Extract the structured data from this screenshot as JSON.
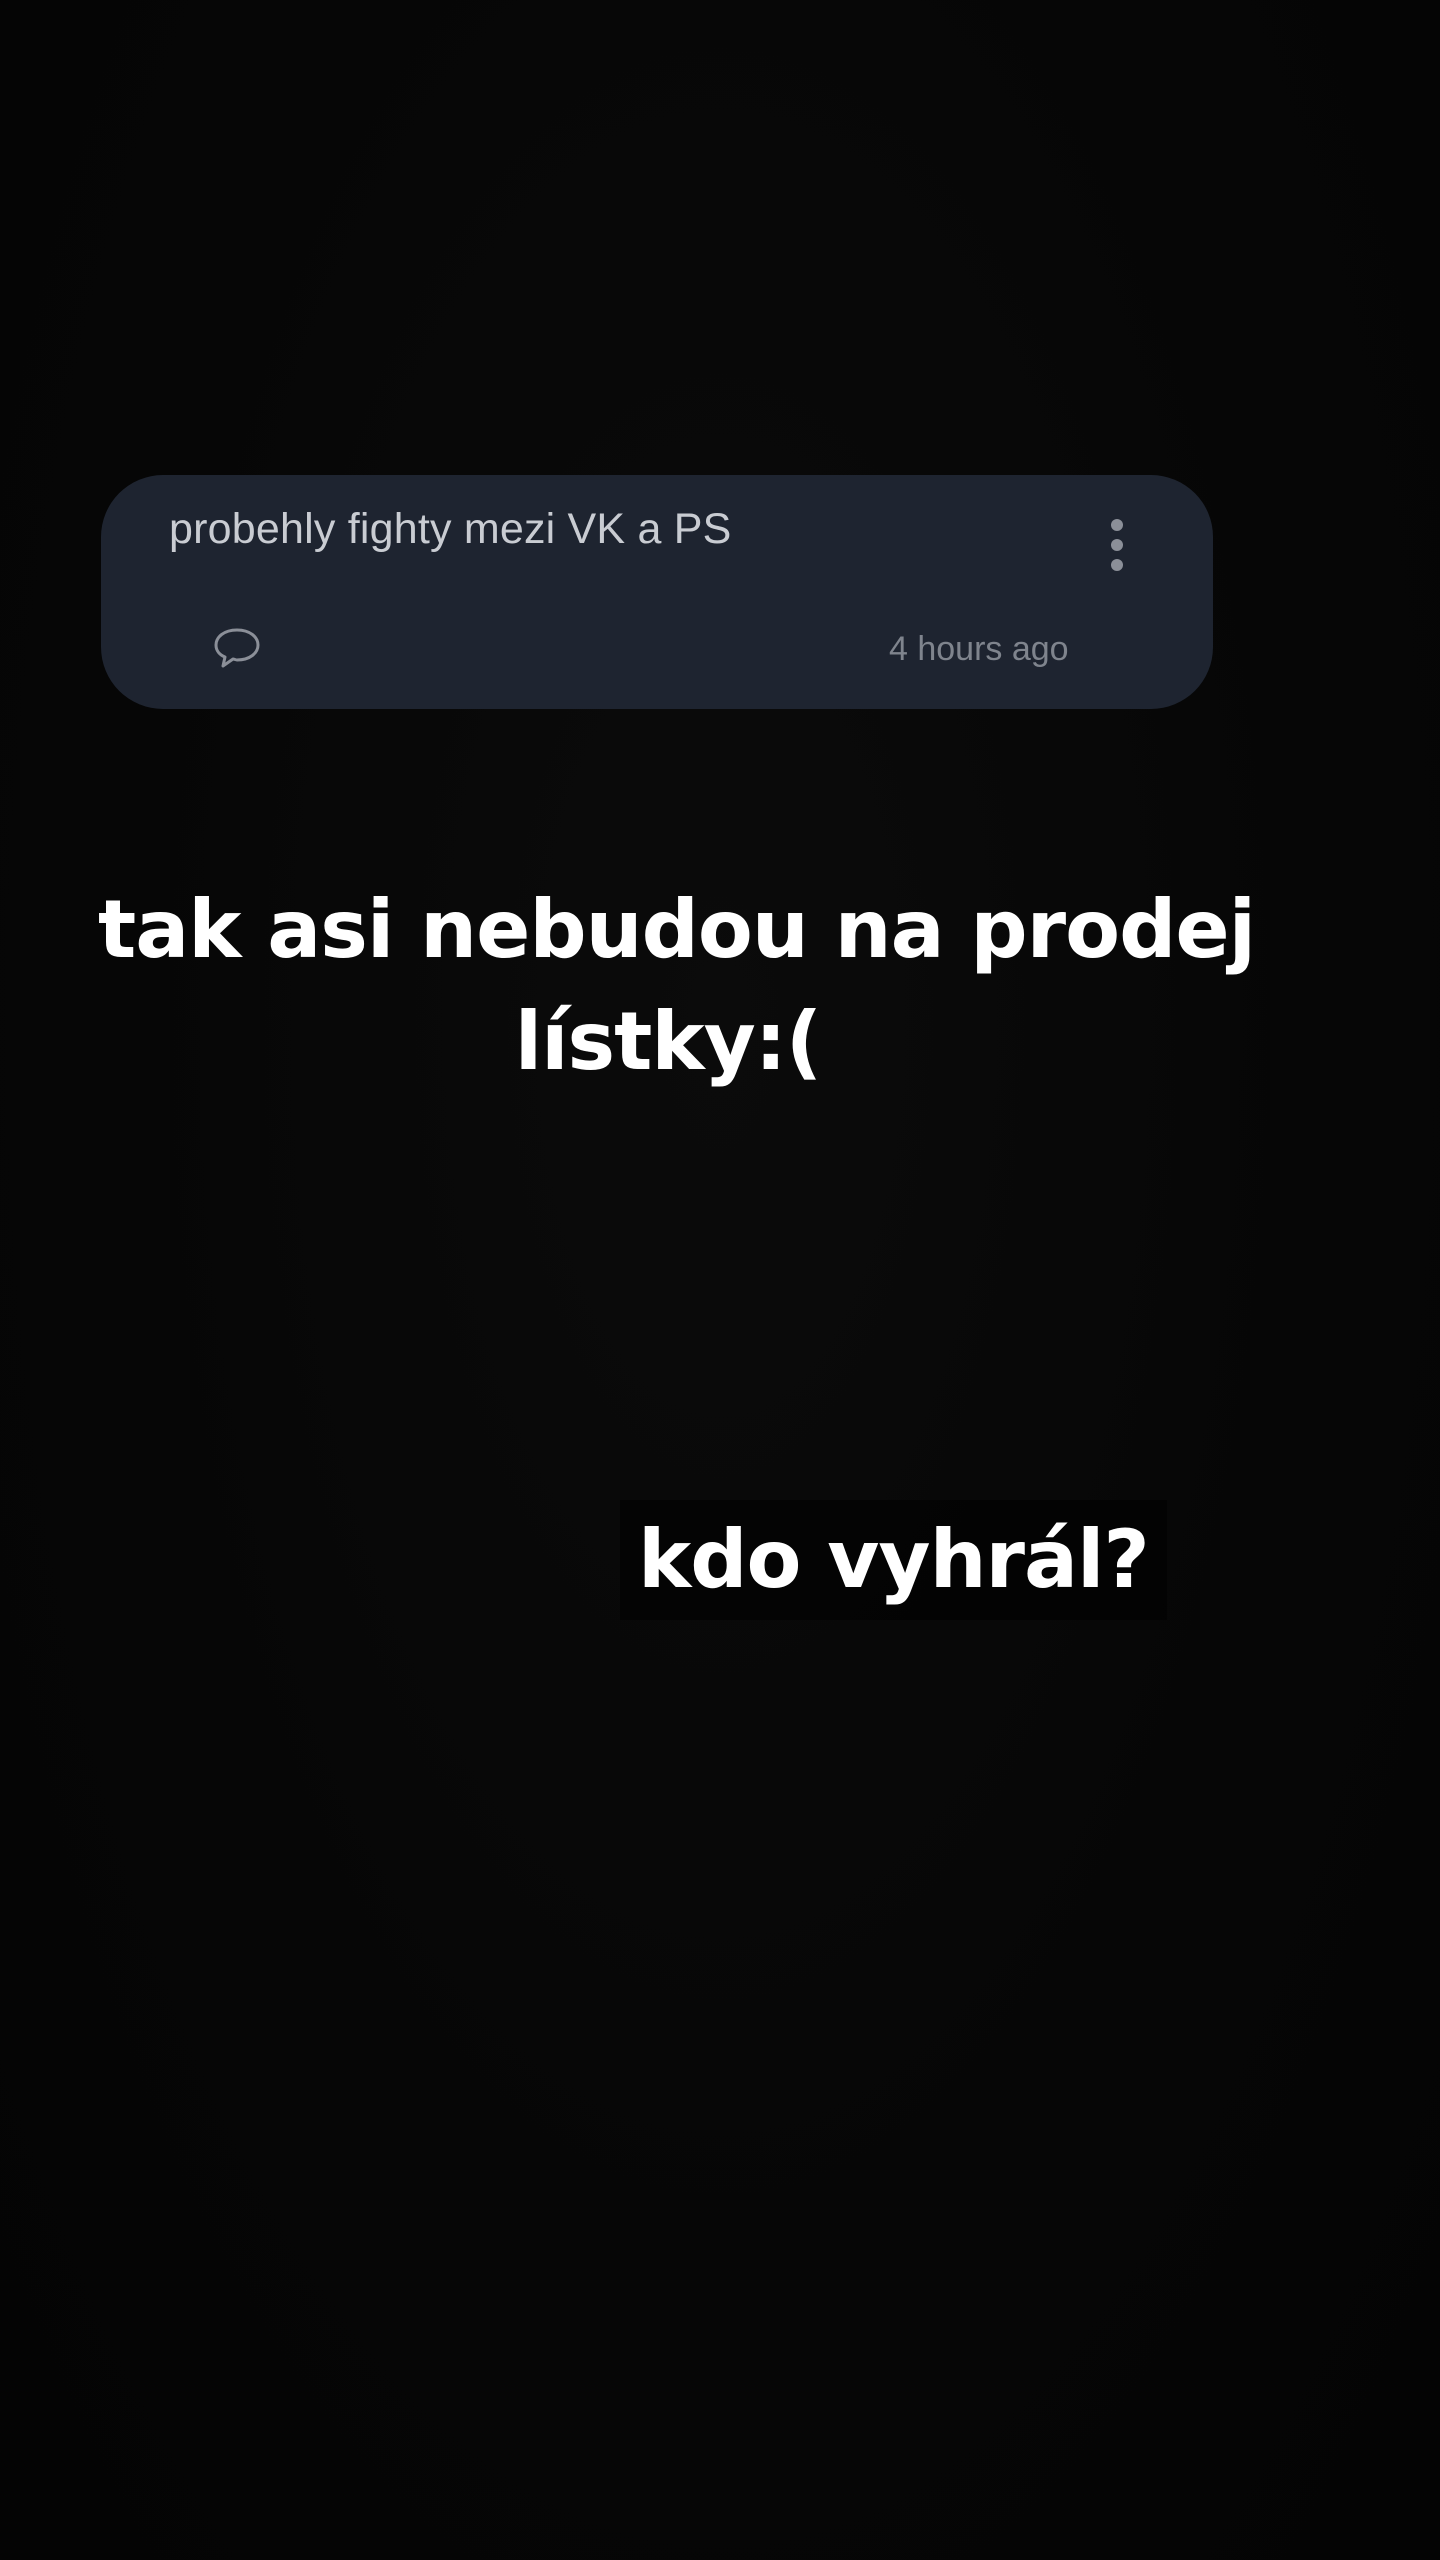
{
  "post": {
    "text": "probehly fighty mezi VK a PS",
    "timestamp": "4 hours ago",
    "more_icon": "more-vertical-icon",
    "comment_icon": "comment-bubble-icon",
    "colors": {
      "card_background": "#1e2430",
      "text": "#c9ccd2",
      "meta": "#7f848d"
    }
  },
  "captions": {
    "line1": "tak asi nebudou na prodej",
    "line2": "lístky:(",
    "line3": "kdo vyhrál?"
  }
}
